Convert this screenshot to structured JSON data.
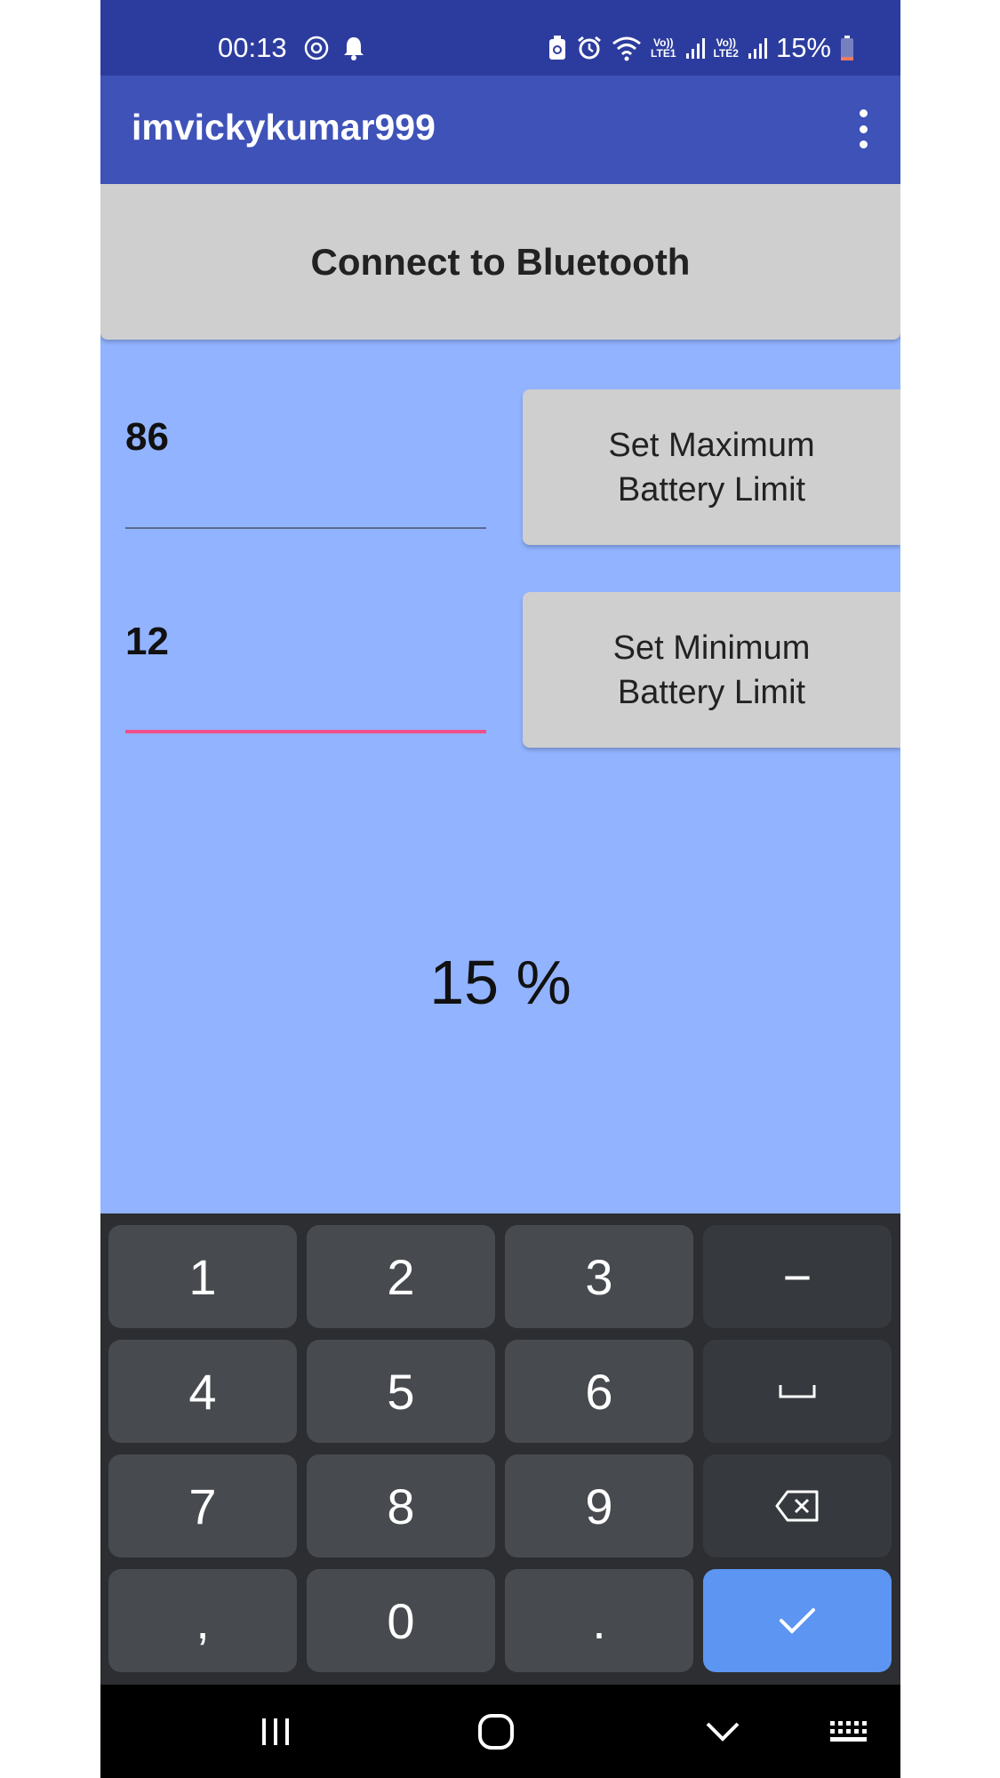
{
  "status_bar": {
    "time": "00:13",
    "battery_text": "15%",
    "sim1_label_top": "Vo))",
    "sim1_label_bottom": "LTE1",
    "sim2_label_top": "Vo))",
    "sim2_label_bottom": "LTE2",
    "battery_level": 0.15,
    "battery_fill_color": "#ff7a5c"
  },
  "app_bar": {
    "title": "imvickykumar999"
  },
  "main": {
    "connect_button": "Connect to Bluetooth",
    "max_limit_value": "86",
    "max_limit_button_line1": "Set Maximum",
    "max_limit_button_line2": "Battery Limit",
    "min_limit_value": "12",
    "min_limit_button_line1": "Set Minimum",
    "min_limit_button_line2": "Battery Limit",
    "battery_percentage": "15 %",
    "focused_field_color": "#f0508a",
    "background_color": "#92b3ff"
  },
  "keyboard": {
    "keys": [
      "1",
      "2",
      "3",
      "−",
      "4",
      "5",
      "6",
      "space",
      "7",
      "8",
      "9",
      "backspace",
      ",",
      "0",
      ".",
      "done"
    ],
    "key_1": "1",
    "key_2": "2",
    "key_3": "3",
    "key_minus": "−",
    "key_4": "4",
    "key_5": "5",
    "key_6": "6",
    "key_7": "7",
    "key_8": "8",
    "key_9": "9",
    "key_comma": ",",
    "key_0": "0",
    "key_period": ".",
    "accent_color": "#5c95f2"
  },
  "icons": [
    "sync-icon",
    "notification-bell-icon",
    "battery-saver-icon",
    "alarm-icon",
    "wifi-icon",
    "signal-icon",
    "battery-icon",
    "overflow-menu-icon",
    "space-key-icon",
    "backspace-icon",
    "checkmark-icon",
    "recents-icon",
    "home-icon",
    "back-icon",
    "keyboard-icon"
  ]
}
